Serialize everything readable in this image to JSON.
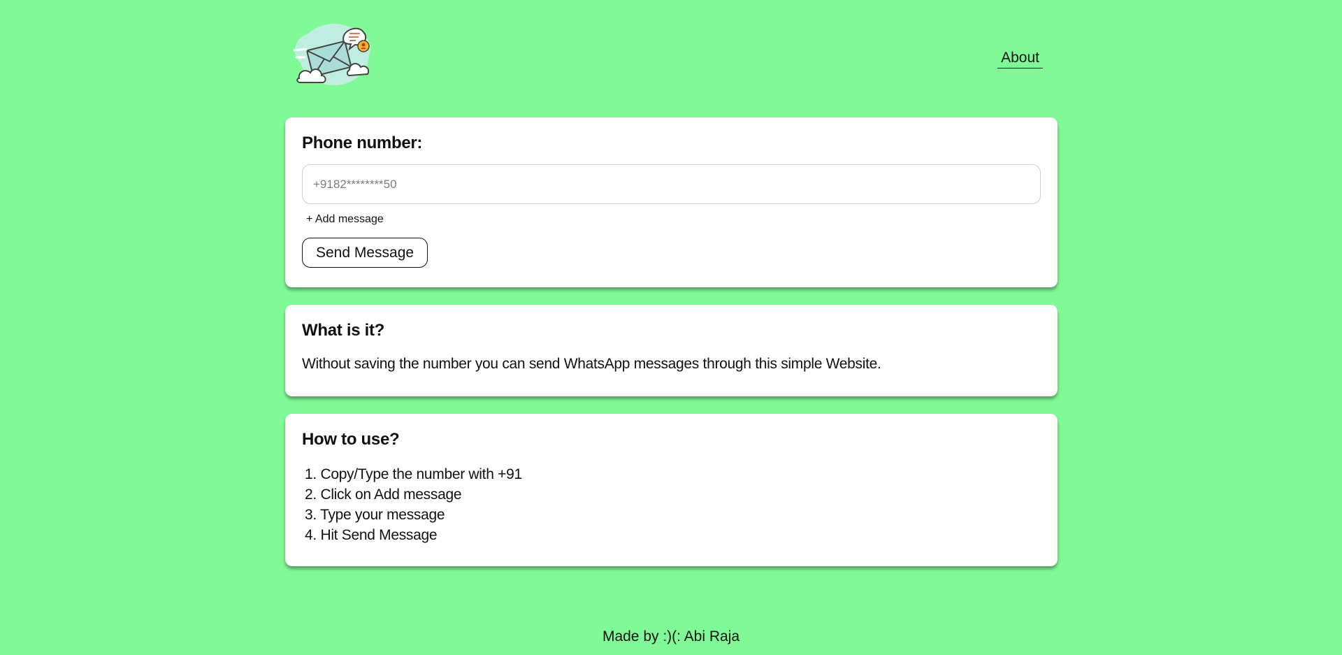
{
  "header": {
    "logo_icon": "mail-cloud-logo-icon",
    "about_label": "About"
  },
  "form": {
    "title": "Phone number:",
    "phone_placeholder": "+9182********50",
    "add_message_label": "+ Add message",
    "send_label": "Send Message"
  },
  "what": {
    "title": "What is it?",
    "text": "Without saving the number you can send WhatsApp messages through this simple Website."
  },
  "how": {
    "title": "How to use?",
    "steps": [
      "1. Copy/Type the number with +91",
      "2. Click on Add message",
      "3. Type your message",
      "4. Hit Send Message"
    ]
  },
  "footer": {
    "text": "Made by :)(: Abi Raja"
  },
  "colors": {
    "background": "#80fa96",
    "card": "#ffffff",
    "text": "#111111"
  }
}
